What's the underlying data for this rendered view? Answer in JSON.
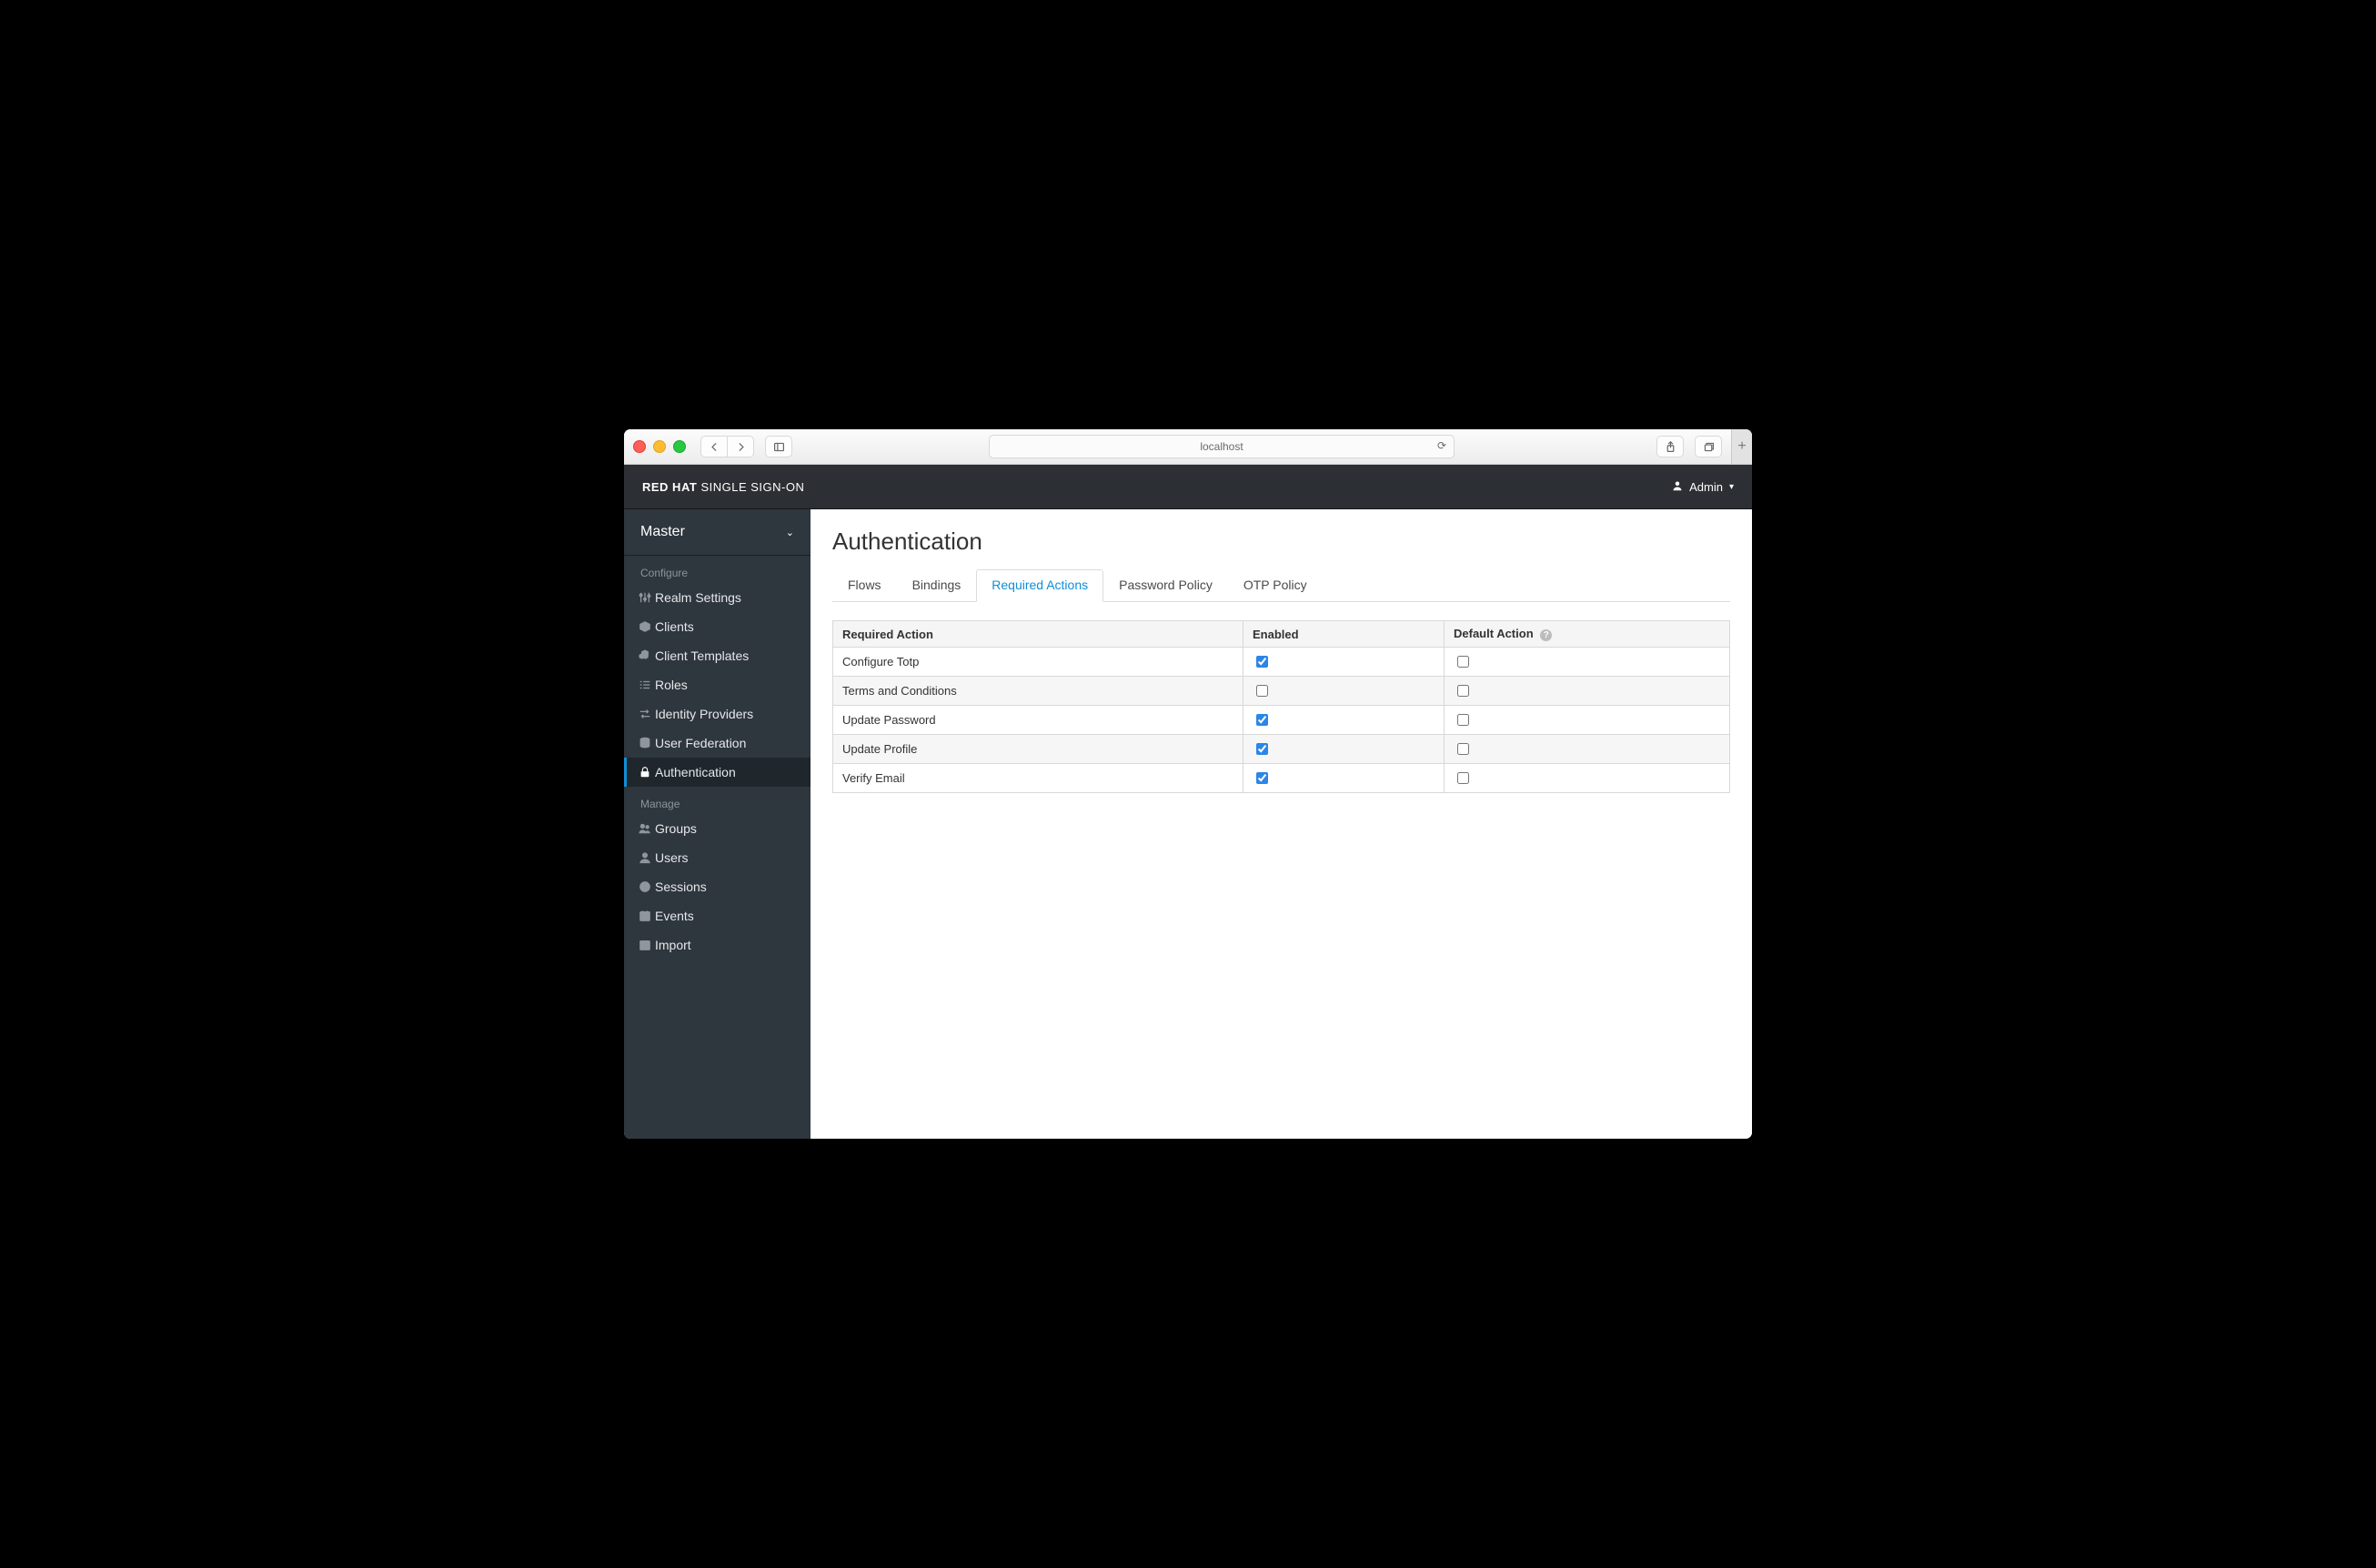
{
  "browser": {
    "url": "localhost"
  },
  "header": {
    "brand_bold": "RED HAT",
    "brand_light": "SINGLE SIGN-ON",
    "user": "Admin"
  },
  "sidebar": {
    "realm": "Master",
    "sections": {
      "configure": {
        "label": "Configure",
        "items": [
          {
            "label": "Realm Settings",
            "icon": "sliders-icon"
          },
          {
            "label": "Clients",
            "icon": "cube-icon"
          },
          {
            "label": "Client Templates",
            "icon": "cubes-icon"
          },
          {
            "label": "Roles",
            "icon": "list-icon"
          },
          {
            "label": "Identity Providers",
            "icon": "exchange-icon"
          },
          {
            "label": "User Federation",
            "icon": "database-icon"
          },
          {
            "label": "Authentication",
            "icon": "lock-icon",
            "active": true
          }
        ]
      },
      "manage": {
        "label": "Manage",
        "items": [
          {
            "label": "Groups",
            "icon": "users-icon"
          },
          {
            "label": "Users",
            "icon": "user-icon"
          },
          {
            "label": "Sessions",
            "icon": "clock-icon"
          },
          {
            "label": "Events",
            "icon": "calendar-icon"
          },
          {
            "label": "Import",
            "icon": "import-icon"
          }
        ]
      }
    }
  },
  "page": {
    "title": "Authentication",
    "tabs": [
      {
        "label": "Flows"
      },
      {
        "label": "Bindings"
      },
      {
        "label": "Required Actions",
        "active": true
      },
      {
        "label": "Password Policy"
      },
      {
        "label": "OTP Policy"
      }
    ],
    "table": {
      "headers": {
        "name": "Required Action",
        "enabled": "Enabled",
        "default": "Default Action"
      },
      "rows": [
        {
          "name": "Configure Totp",
          "enabled": true,
          "default": false
        },
        {
          "name": "Terms and Conditions",
          "enabled": false,
          "default": false
        },
        {
          "name": "Update Password",
          "enabled": true,
          "default": false
        },
        {
          "name": "Update Profile",
          "enabled": true,
          "default": false
        },
        {
          "name": "Verify Email",
          "enabled": true,
          "default": false
        }
      ]
    }
  }
}
